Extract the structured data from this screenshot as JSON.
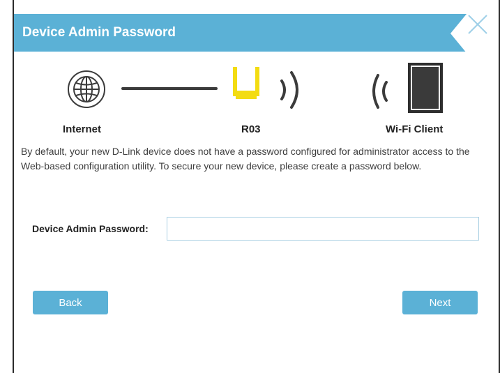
{
  "dialog": {
    "title": "Device Admin Password",
    "close_icon": "close-icon"
  },
  "diagram": {
    "internet_label": "Internet",
    "router_label": "R03",
    "client_label": "Wi-Fi Client",
    "icons": [
      "globe-icon",
      "connection-line",
      "router-icon",
      "wifi-signal-icon",
      "tablet-icon"
    ],
    "colors": {
      "router": "#f3dc12",
      "accent": "#5bb1d6",
      "icon_dark": "#3b3b3b"
    }
  },
  "description": "By default, your new D-Link device does not have a password configured for administrator access to the Web-based configuration utility. To secure your new device, please create a password below.",
  "form": {
    "password_label": "Device Admin Password:",
    "password_value": "",
    "password_placeholder": ""
  },
  "buttons": {
    "back": "Back",
    "next": "Next"
  }
}
